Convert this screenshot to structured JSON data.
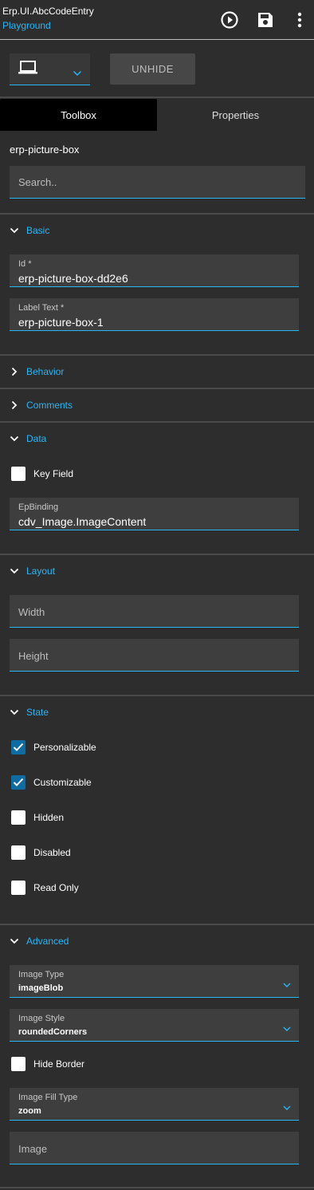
{
  "header": {
    "title": "Erp.UI.AbcCodeEntry",
    "subtitle": "Playground",
    "icons": [
      "play-circle-icon",
      "save-icon",
      "more-vertical-icon"
    ]
  },
  "toolbar": {
    "device_icon": "laptop-icon",
    "unhide_label": "UNHIDE"
  },
  "tabs": [
    {
      "label": "Toolbox",
      "active": true
    },
    {
      "label": "Properties",
      "active": false
    }
  ],
  "component_name": "erp-picture-box",
  "search": {
    "placeholder": "Search..",
    "value": ""
  },
  "sections": {
    "basic": {
      "title": "Basic",
      "expanded": true,
      "id": {
        "label": "Id *",
        "value": "erp-picture-box-dd2e6"
      },
      "label_text": {
        "label": "Label Text *",
        "value": "erp-picture-box-1"
      }
    },
    "behavior": {
      "title": "Behavior",
      "expanded": false
    },
    "comments": {
      "title": "Comments",
      "expanded": false
    },
    "data": {
      "title": "Data",
      "expanded": true,
      "key_field": {
        "label": "Key Field",
        "checked": false
      },
      "ep_binding": {
        "label": "EpBinding",
        "value": "cdv_Image.ImageContent"
      }
    },
    "layout": {
      "title": "Layout",
      "expanded": true,
      "width": {
        "placeholder": "Width"
      },
      "height": {
        "placeholder": "Height"
      }
    },
    "state": {
      "title": "State",
      "expanded": true,
      "items": [
        {
          "label": "Personalizable",
          "checked": true
        },
        {
          "label": "Customizable",
          "checked": true
        },
        {
          "label": "Hidden",
          "checked": false
        },
        {
          "label": "Disabled",
          "checked": false
        },
        {
          "label": "Read Only",
          "checked": false
        }
      ]
    },
    "advanced": {
      "title": "Advanced",
      "expanded": true,
      "image_type": {
        "label": "Image Type",
        "value": "imageBlob"
      },
      "image_style": {
        "label": "Image Style",
        "value": "roundedCorners"
      },
      "hide_border": {
        "label": "Hide Border",
        "checked": false
      },
      "image_fill_type": {
        "label": "Image Fill Type",
        "value": "zoom"
      },
      "image": {
        "placeholder": "Image"
      }
    }
  },
  "colors": {
    "accent": "#29b6f6",
    "background": "#2d2d2d",
    "field_bg": "#3e3e3e",
    "checkbox_checked": "#0f6ca3"
  }
}
